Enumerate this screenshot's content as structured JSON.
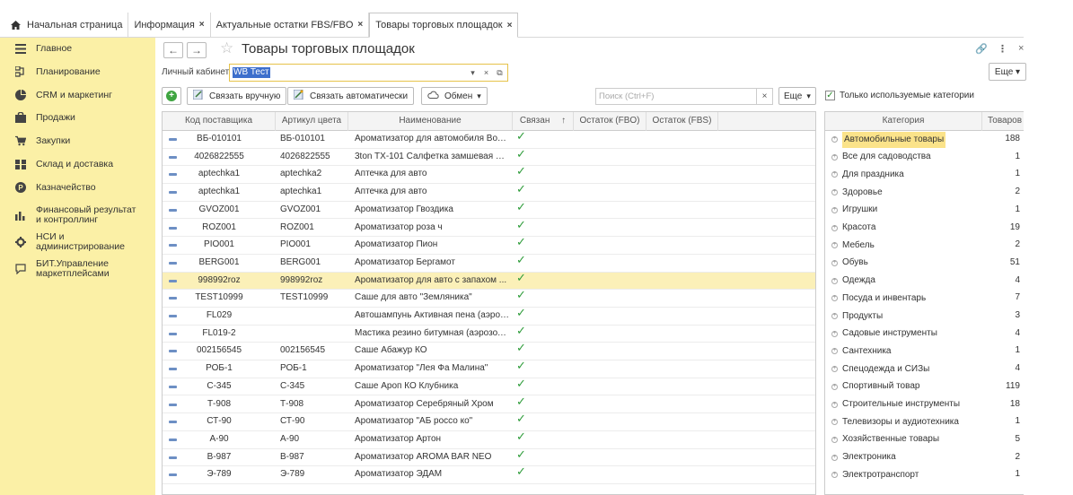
{
  "tabs": [
    {
      "label": "Начальная страница",
      "closable": false,
      "active": false
    },
    {
      "label": "Информация",
      "closable": true,
      "active": false
    },
    {
      "label": "Актуальные остатки FBS/FBO",
      "closable": true,
      "active": false
    },
    {
      "label": "Товары торговых площадок",
      "closable": true,
      "active": true
    }
  ],
  "sidebar": {
    "items": [
      {
        "label": "Главное",
        "icon": "menu-icon"
      },
      {
        "label": "Планирование",
        "icon": "planning-icon"
      },
      {
        "label": "CRM и маркетинг",
        "icon": "crm-icon"
      },
      {
        "label": "Продажи",
        "icon": "bag-icon"
      },
      {
        "label": "Закупки",
        "icon": "cart-icon"
      },
      {
        "label": "Склад и доставка",
        "icon": "warehouse-icon"
      },
      {
        "label": "Казначейство",
        "icon": "coin-icon"
      },
      {
        "label": "Финансовый результат и контроллинг",
        "icon": "chart-icon"
      },
      {
        "label": "НСИ и администрирование",
        "icon": "gear-icon"
      },
      {
        "label": "БИТ.Управление маркетплейсами",
        "icon": "chat-icon"
      }
    ]
  },
  "header": {
    "title": "Товары торговых площадок",
    "back": "←",
    "forward": "→",
    "link_icon": "🔗",
    "menu_icon": "⋮",
    "close_icon": "×"
  },
  "cabinet": {
    "label": "Личный кабинет:",
    "value": "WB Тест"
  },
  "toolbar": {
    "more_top": "Еще",
    "link_manual": "Связать вручную",
    "link_auto": "Связать автоматически",
    "exchange": "Обмен",
    "search_placeholder": "Поиск (Ctrl+F)",
    "more": "Еще",
    "only_used": "Только используемые категории"
  },
  "table": {
    "columns": [
      "Код поставщика",
      "Артикул цвета",
      "Наименование",
      "Связан",
      "Остаток (FBO)",
      "Остаток (FBS)"
    ],
    "sort_indicator": "↑",
    "rows": [
      {
        "code": "ВБ-010101",
        "art": "ВБ-010101",
        "name": "Ароматизатор для автомобиля Вол...",
        "linked": true
      },
      {
        "code": "4026822555",
        "art": "4026822555",
        "name": "3ton TX-101 Салфетка замшевая по...",
        "linked": true
      },
      {
        "code": "aptechka1",
        "art": "aptechka2",
        "name": "Аптечка для авто",
        "linked": true
      },
      {
        "code": "aptechka1",
        "art": "aptechka1",
        "name": "Аптечка для авто",
        "linked": true
      },
      {
        "code": "GVOZ001",
        "art": "GVOZ001",
        "name": "Ароматизатор Гвоздика",
        "linked": true
      },
      {
        "code": "ROZ001",
        "art": "ROZ001",
        "name": "Ароматизатор роза ч",
        "linked": true
      },
      {
        "code": "PIO001",
        "art": "PIO001",
        "name": "Ароматизатор Пион",
        "linked": true
      },
      {
        "code": "BERG001",
        "art": "BERG001",
        "name": "Ароматизатор Бергамот",
        "linked": true
      },
      {
        "code": "998992roz",
        "art": "998992roz",
        "name": "Ароматизатор для авто с запахом ...",
        "linked": true,
        "selected": true
      },
      {
        "code": "TEST10999",
        "art": "TEST10999",
        "name": "Саше для авто \"Земляника\"",
        "linked": true
      },
      {
        "code": "FL029",
        "art": "",
        "name": "Автошампунь Активная пена (аэрозо...",
        "linked": true
      },
      {
        "code": "FL019-2",
        "art": "",
        "name": "Мастика резино битумная (аэрозол...",
        "linked": true
      },
      {
        "code": "002156545",
        "art": "002156545",
        "name": "Саше Абажур КО",
        "linked": true
      },
      {
        "code": "РОБ-1",
        "art": "РОБ-1",
        "name": "Ароматизатор \"Лея Фа Малина\"",
        "linked": true
      },
      {
        "code": "С-345",
        "art": "С-345",
        "name": "Саше Ароп КО Клубника",
        "linked": true
      },
      {
        "code": "Т-908",
        "art": "Т-908",
        "name": "Ароматизатор Серебряный Хром",
        "linked": true
      },
      {
        "code": "СТ-90",
        "art": "СТ-90",
        "name": "Ароматизатор \"АБ россо ко\"",
        "linked": true
      },
      {
        "code": "А-90",
        "art": "А-90",
        "name": "Ароматизатор Артон",
        "linked": true
      },
      {
        "code": "В-987",
        "art": "В-987",
        "name": "Ароматизатор AROMA BAR NEO",
        "linked": true
      },
      {
        "code": "Э-789",
        "art": "Э-789",
        "name": "Ароматизатор ЭДАМ",
        "linked": true
      }
    ]
  },
  "categories": {
    "columns": [
      "Категория",
      "Товаров"
    ],
    "rows": [
      {
        "name": "Автомобильные товары",
        "count": "188",
        "selected": true
      },
      {
        "name": "Все для садоводства",
        "count": "1"
      },
      {
        "name": "Для праздника",
        "count": "1"
      },
      {
        "name": "Здоровье",
        "count": "2"
      },
      {
        "name": "Игрушки",
        "count": "1"
      },
      {
        "name": "Красота",
        "count": "19"
      },
      {
        "name": "Мебель",
        "count": "2"
      },
      {
        "name": "Обувь",
        "count": "51"
      },
      {
        "name": "Одежда",
        "count": "4"
      },
      {
        "name": "Посуда и инвентарь",
        "count": "7"
      },
      {
        "name": "Продукты",
        "count": "3"
      },
      {
        "name": "Садовые инструменты",
        "count": "4"
      },
      {
        "name": "Сантехника",
        "count": "1"
      },
      {
        "name": "Спецодежда и СИЗы",
        "count": "4"
      },
      {
        "name": "Спортивный товар",
        "count": "119"
      },
      {
        "name": "Строительные инструменты",
        "count": "18"
      },
      {
        "name": "Телевизоры и аудиотехника",
        "count": "1"
      },
      {
        "name": "Хозяйственные товары",
        "count": "5"
      },
      {
        "name": "Электроника",
        "count": "2"
      },
      {
        "name": "Электротранспорт",
        "count": "1"
      }
    ]
  },
  "colors": {
    "sidebar_bg": "#fbf0a6",
    "selection": "#fbf0b8",
    "check_green": "#2e9c3a",
    "accent_blue": "#3d6fcc"
  }
}
